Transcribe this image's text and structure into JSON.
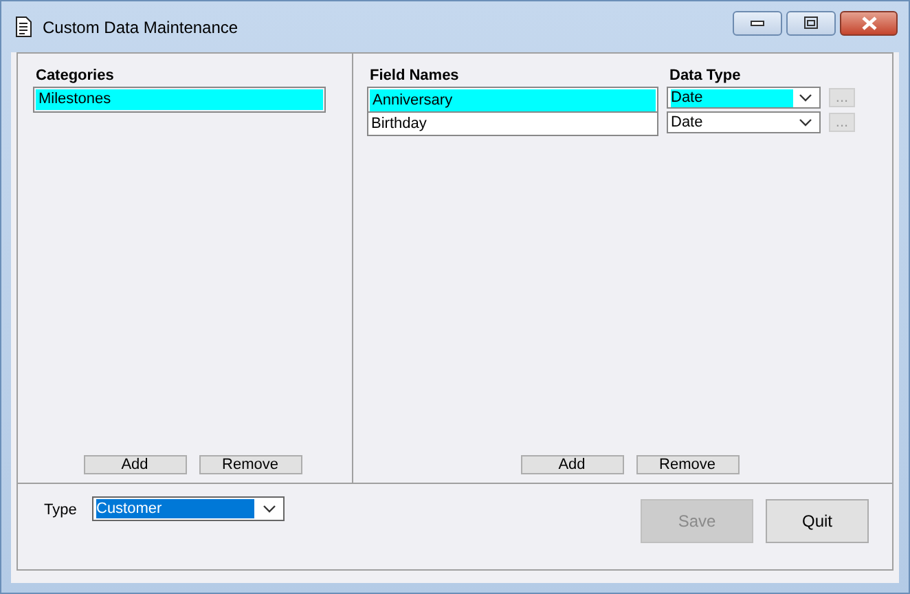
{
  "window": {
    "title": "Custom Data Maintenance"
  },
  "categories": {
    "heading": "Categories",
    "items": [
      {
        "label": "Milestones",
        "selected": true
      }
    ],
    "buttons": [
      "Add",
      "Remove"
    ]
  },
  "fields": {
    "name_heading": "Field Names",
    "type_heading": "Data Type",
    "rows": [
      {
        "name": "Anniversary",
        "data_type": "Date",
        "selected": true
      },
      {
        "name": "Birthday",
        "data_type": "Date",
        "selected": false
      }
    ],
    "ellipsis": "...",
    "buttons": [
      "Add",
      "Remove"
    ]
  },
  "type": {
    "label": "Type",
    "value": "Customer"
  },
  "actions": [
    {
      "label": "Save",
      "disabled": true
    },
    {
      "label": "Quit",
      "disabled": false
    }
  ]
}
